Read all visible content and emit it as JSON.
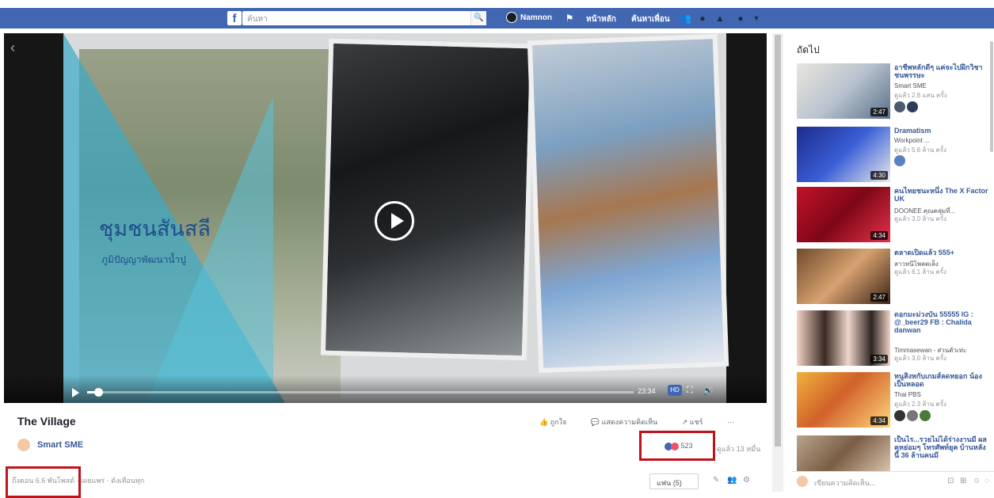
{
  "topbar": {
    "logo": "f",
    "search_placeholder": "ค้นหา",
    "search_icon": "🔍",
    "profile_name": "Namnon",
    "home": "หน้าหลัก",
    "find_friends": "ค้นหาเพื่อน",
    "icons": [
      "friends-icon",
      "messenger-icon",
      "notifications-icon",
      "help-icon",
      "menu-icon"
    ]
  },
  "video": {
    "overlay_title": "ชุมชนสันสลี",
    "overlay_subtitle": "ภูมิปัญญาพัฒนาน้ำปู",
    "progress": 0.02,
    "time": "23:34",
    "hd": "HD"
  },
  "post": {
    "title": "The Village",
    "page_name": "Smart SME",
    "actions": [
      "ถูกใจ",
      "แสดงความคิดเห็น",
      "แชร์"
    ],
    "reaction_count": "523",
    "views": "ดูแล้ว 13 หมื่น",
    "meta": "ถึงตอน 6.6 พันโพสต์ · เผยแพร่ · ดังเทือนทุก",
    "sort_label": "แฟน (5)"
  },
  "sidebar": {
    "header": "ถัดไป",
    "items": [
      {
        "title": "อาชีพหลักดีๆ แค่จะไปฝึกวิชาชนพรรษะ",
        "page": "Smart SME",
        "views": "ดูแล้ว 2.8 แสน ครั้ง",
        "duration": "2:47"
      },
      {
        "title": "Dramatism",
        "page": "Workpoint ...",
        "views": "ดูแล้ว 5.6 ล้าน ครั้ง",
        "duration": "4:30"
      },
      {
        "title": "คนไทยชนะหนึ่ง The X Factor UK",
        "page": "DOONEE คุณคลุ่มที่...",
        "views": "ดูแล้ว 3.0 ล้าน ครั้ง",
        "duration": "4:34"
      },
      {
        "title": "ตลาดเปิดแล้ว 555+",
        "page": "สาวหนีโพลตเล็ง",
        "views": "ดูแล้ว 6.1 ล้าน ครั้ง",
        "duration": "2:47"
      },
      {
        "title": "ดอกมะม่วงบัน 55555 IG : @_beer29 FB : Chalida danwan",
        "page": "Timmasewan - ส่วนตัวเท่ะ",
        "views": "ดูแล้ว 3.0 ล้าน ครั้ง",
        "duration": "3:34"
      },
      {
        "title": "หนูสิงหกับเกมส์ลดหยอก น้องเป็นหลอด",
        "page": "Thai PBS",
        "views": "ดูแล้ว 2.3 ล้าน ครั้ง",
        "duration": "4:34"
      },
      {
        "title": "เป็นไร...รวยไม่ได้ร่างงานมี ผลคหย่อมๆ โทรศัพท์ยุค บ้านหลังนี้ 36 ล้านคนมี",
        "page": "",
        "views": "",
        "duration": ""
      }
    ]
  },
  "chat": {
    "placeholder": "เขียนความคิดเห็น..."
  },
  "colors": {
    "brand": "#4267b2",
    "highlight": "#c0121a",
    "link": "#385898"
  }
}
